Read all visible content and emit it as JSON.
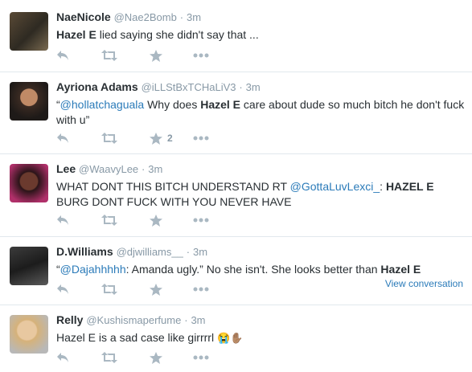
{
  "tweets": [
    {
      "name": "NaeNicole",
      "handle": "@Nae2Bomb",
      "sep": "·",
      "time": "3m",
      "text_parts": [
        "Hazel E",
        " lied saying she didn't say that ..."
      ],
      "retweet_count": ""
    },
    {
      "name": "Ayriona Adams",
      "handle": "@iLLStBxTCHaLiV3",
      "sep": "·",
      "time": "3m",
      "text_parts": [
        "“",
        "@hollatchaguala",
        " Why does ",
        "Hazel E",
        " care about dude so much bitch he don't fuck with u”"
      ],
      "retweet_count": "2"
    },
    {
      "name": "Lee",
      "handle": "@WaavyLee",
      "sep": "·",
      "time": "3m",
      "text_parts": [
        "WHAT DONT THIS BITCH UNDERSTAND RT ",
        "@GottaLuvLexci_",
        ": ",
        "HAZEL E",
        " BURG DONT FUCK WITH YOU NEVER HAVE"
      ],
      "retweet_count": ""
    },
    {
      "name": "D.Williams",
      "handle": "@djwilliams__",
      "sep": "·",
      "time": "3m",
      "text_parts": [
        "“",
        "@Dajahhhhh",
        ": Amanda ugly.” No she isn't. She looks better than ",
        "Hazel E"
      ],
      "retweet_count": "",
      "view_conversation": "View conversation"
    },
    {
      "name": "Relly",
      "handle": "@Kushismaperfume",
      "sep": "·",
      "time": "3m",
      "text_parts": [
        "Hazel E is a sad case like girrrrl ",
        "😭✋🏽"
      ],
      "retweet_count": ""
    }
  ],
  "colors": {
    "link": "#2b7bb9",
    "meta": "#8899a6",
    "text": "#292f33",
    "action_icon": "#aab8c2"
  },
  "icons": [
    "reply-icon",
    "retweet-icon",
    "favorite-star-icon",
    "more-dots-icon"
  ]
}
